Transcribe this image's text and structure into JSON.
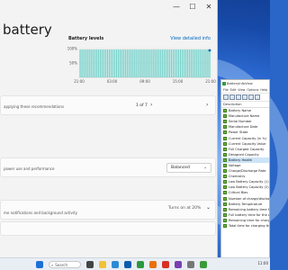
{
  "settings": {
    "page_title": "battery",
    "chart_title": "Battery levels",
    "chart_link": "View detailed info",
    "recommendations_text": "applying these recommendations",
    "pager_text": "1 of 7",
    "power_mode_desc": "power use and performance",
    "power_mode_value": "Balanced",
    "saver_desc": "me notifications and background activity",
    "saver_value": "Turns on at 20%"
  },
  "chart_data": {
    "type": "bar",
    "categories": [
      "21:00",
      "",
      "",
      "",
      "03:00",
      "",
      "",
      "",
      "09:00",
      "",
      "",
      "",
      "15:00",
      "",
      "",
      "",
      "21:00"
    ],
    "values": [
      97,
      97,
      97,
      97,
      97,
      97,
      97,
      97,
      97,
      97,
      97,
      97,
      97,
      97,
      97,
      97,
      97,
      97,
      97,
      97,
      97,
      97,
      97,
      97,
      97,
      97,
      97,
      97,
      97,
      97,
      97,
      97,
      97,
      97,
      97,
      97,
      97,
      97,
      97,
      97,
      97,
      97,
      97,
      97,
      97,
      97,
      97,
      97,
      97,
      97,
      97,
      97,
      97,
      97,
      97,
      97,
      97,
      97,
      97,
      97,
      97,
      97,
      97,
      97,
      97,
      97,
      97,
      97,
      97,
      97,
      97,
      97
    ],
    "ylim": [
      0,
      100
    ],
    "yticks": [
      "100%",
      "50%"
    ],
    "xticks": [
      "21:00",
      "03:00",
      "09:00",
      "15:00",
      "21:00"
    ],
    "bar_color": "#6dd0c8"
  },
  "biv": {
    "title": "BatteryInfoView",
    "menu": [
      "File",
      "Edit",
      "View",
      "Options",
      "Help"
    ],
    "column": "Description",
    "rows": [
      "Battery Name",
      "Manufacture Name",
      "Serial Number",
      "Manufacture Date",
      "Power State",
      "Current Capacity (in %)",
      "Current Capacity Value",
      "Full Charged Capacity",
      "Designed Capacity",
      "Battery Health",
      "Voltage",
      "Charge/Discharge Rate",
      "Chemistry",
      "Low Battery Capacity (1)",
      "Low Battery Capacity (2)",
      "Critical Bias",
      "Number of charge/discharge",
      "Battery Temperature",
      "Remaining battery time for",
      "Full battery time for the cur",
      "Remaining time for chargin",
      "Total time for charging the"
    ],
    "selected_index": 9
  },
  "taskbar": {
    "search_placeholder": "Search",
    "time": "11:00"
  }
}
